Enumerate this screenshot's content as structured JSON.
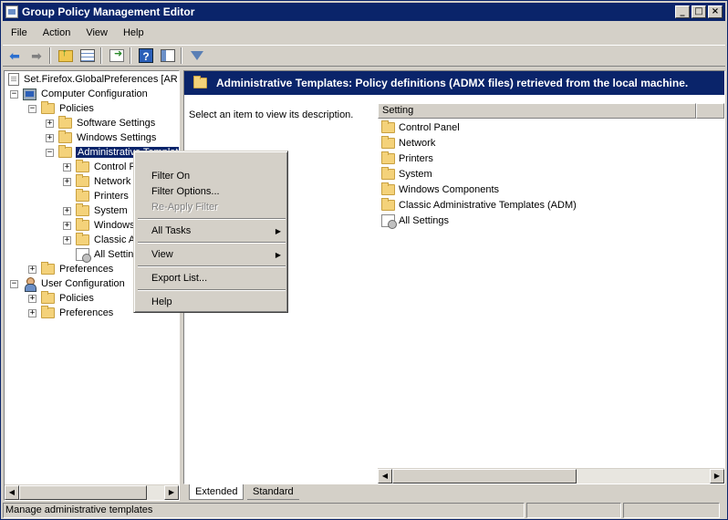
{
  "window": {
    "title": "Group Policy Management Editor"
  },
  "menubar": [
    "File",
    "Action",
    "View",
    "Help"
  ],
  "tree": {
    "root": "Set.Firefox.GlobalPreferences [AR",
    "computer_config": "Computer Configuration",
    "policies": "Policies",
    "software_settings": "Software Settings",
    "windows_settings": "Windows Settings",
    "admin_templates": "Administrative Templat",
    "control_panel": "Control P",
    "network": "Network",
    "printers": "Printers",
    "system": "System",
    "windows_components": "Windows",
    "classic": "Classic A",
    "all_settings": "All Settin",
    "preferences": "Preferences",
    "user_config": "User Configuration",
    "user_policies": "Policies",
    "user_preferences": "Preferences"
  },
  "right_pane": {
    "header": "Administrative Templates: Policy definitions (ADMX files) retrieved from the local machine.",
    "description": "Select an item to view its description.",
    "column_setting": "Setting",
    "items": [
      "Control Panel",
      "Network",
      "Printers",
      "System",
      "Windows Components",
      "Classic Administrative Templates (ADM)",
      "All Settings"
    ]
  },
  "tabs": {
    "extended": "Extended",
    "standard": "Standard"
  },
  "context_menu": {
    "filter_on": "Filter On",
    "filter_options": "Filter Options...",
    "reapply_filter": "Re-Apply Filter",
    "all_tasks": "All Tasks",
    "view": "View",
    "export_list": "Export List...",
    "help": "Help"
  },
  "statusbar": {
    "text": "Manage administrative templates"
  },
  "icons": {
    "back": "back-arrow-icon",
    "forward": "forward-arrow-icon",
    "up": "up-folder-icon",
    "show_hide": "show-hide-tree-icon",
    "export": "export-list-icon",
    "help": "help-icon",
    "properties": "properties-pane-icon",
    "filter": "filter-icon"
  },
  "colors": {
    "title_bar": "#0a246a",
    "selection": "#0a246a",
    "chrome": "#d4d0c8",
    "folder": "#f4d27a"
  }
}
